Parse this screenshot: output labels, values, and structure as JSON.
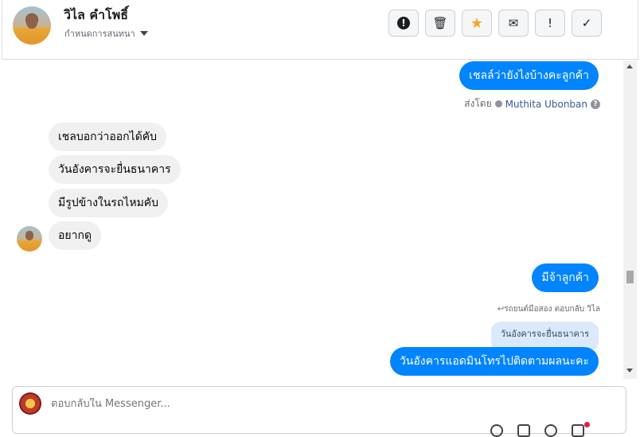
{
  "header": {
    "contact_name": "วิไล คำโพธิ์",
    "subtitle": "กำหนดการสนทนา",
    "toolbar": [
      {
        "icon": "alert-circle-icon",
        "glyph": "!"
      },
      {
        "icon": "trash-icon",
        "glyph": "🗑"
      },
      {
        "icon": "star-icon",
        "glyph": "★"
      },
      {
        "icon": "mark-unread-icon",
        "glyph": "✉"
      },
      {
        "icon": "exclamation-icon",
        "glyph": "!"
      },
      {
        "icon": "check-icon",
        "glyph": "✓"
      }
    ]
  },
  "messages": [
    {
      "side": "out",
      "text": "เชลล์ว่ายังไงบ้างคะลูกค้า"
    },
    {
      "side": "in",
      "text": "เชลบอกว่าออกได้คับ"
    },
    {
      "side": "in",
      "text": "วันอังคารจะยื่นธนาคาร"
    },
    {
      "side": "in",
      "text": "มีรูปข้างในรถไหมคับ"
    },
    {
      "side": "in",
      "text": "อยากดู"
    },
    {
      "side": "out",
      "text": "มีจ้าลูกค้า"
    },
    {
      "side": "out",
      "text": "วันอังคารแอดมินโทรไปติดตามผลนะคะ"
    }
  ],
  "sent_by": {
    "prefix": "ส่งโดย",
    "name": "Muthita Ubonban",
    "help": "?"
  },
  "reply_meta": "↩รถยนต์มือสอง ตอบกลับ วิไล",
  "quoted_text": "วันอังคารจะยื่นธนาคาร",
  "composer": {
    "placeholder": "ตอบกลับใน Messenger..."
  },
  "colors": {
    "outgoing": "#0084ff",
    "incoming": "#f0f0f0",
    "quote": "#dbe9fc",
    "star": "#f5a623"
  }
}
